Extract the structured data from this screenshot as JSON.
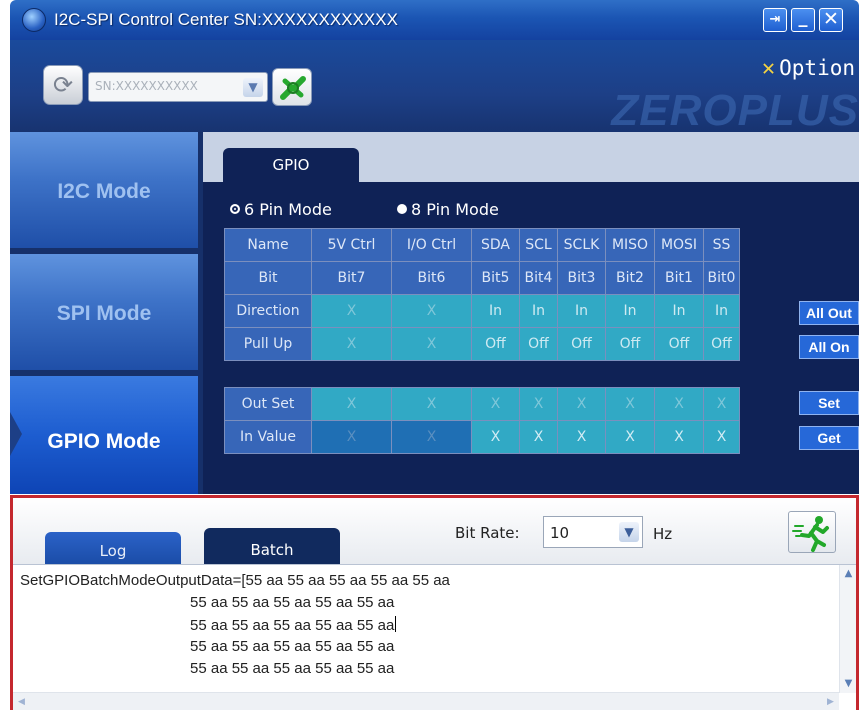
{
  "window": {
    "title": "I2C-SPI Control Center SN:XXXXXXXXXXXX",
    "icon": "app-globe-icon"
  },
  "toolbar": {
    "sn_value": "SN:XXXXXXXXXX",
    "option_label": "Option",
    "brand": "ZEROPLUS"
  },
  "sidebar": {
    "items": [
      {
        "label": "I2C Mode",
        "active": false
      },
      {
        "label": "SPI Mode",
        "active": false
      },
      {
        "label": "GPIO Mode",
        "active": true
      }
    ]
  },
  "gpio": {
    "tab_label": "GPIO",
    "pin_modes": [
      {
        "label": "6 Pin Mode",
        "selected": false
      },
      {
        "label": "8 Pin Mode",
        "selected": true
      }
    ],
    "headers": [
      "Name",
      "5V Ctrl",
      "I/O Ctrl",
      "SDA",
      "SCL",
      "SCLK",
      "MISO",
      "MOSI",
      "SS"
    ],
    "bits": [
      "Bit",
      "Bit7",
      "Bit6",
      "Bit5",
      "Bit4",
      "Bit3",
      "Bit2",
      "Bit1",
      "Bit0"
    ],
    "direction": [
      "Direction",
      "X",
      "X",
      "In",
      "In",
      "In",
      "In",
      "In",
      "In"
    ],
    "pull_up": [
      "Pull Up",
      "X",
      "X",
      "Off",
      "Off",
      "Off",
      "Off",
      "Off",
      "Off"
    ],
    "out_set": [
      "Out Set",
      "X",
      "X",
      "X",
      "X",
      "X",
      "X",
      "X",
      "X"
    ],
    "in_value": [
      "In Value",
      "X",
      "X",
      "X",
      "X",
      "X",
      "X",
      "X",
      "X"
    ],
    "buttons": {
      "all_out": "All Out",
      "all_on": "All On",
      "set": "Set",
      "get": "Get"
    }
  },
  "bottom": {
    "tabs": [
      "Log",
      "Batch"
    ],
    "active_tab": "Batch",
    "bit_rate_label": "Bit Rate:",
    "bit_rate_value": "10",
    "bit_rate_unit": "Hz",
    "log_lines": [
      "SetGPIOBatchModeOutputData=[55 aa 55 aa 55 aa 55 aa 55 aa",
      "55 aa 55 aa 55 aa 55 aa 55 aa",
      "55 aa 55 aa 55 aa 55 aa 55 aa",
      "55 aa 55 aa 55 aa 55 aa 55 aa",
      "55 aa 55 aa 55 aa 55 aa 55 aa"
    ]
  },
  "colors": {
    "highlight_border": "#c4282e",
    "panel_dark": "#0f2256",
    "cell_cyan": "#31a9c5",
    "header_blue": "#3766b8"
  }
}
